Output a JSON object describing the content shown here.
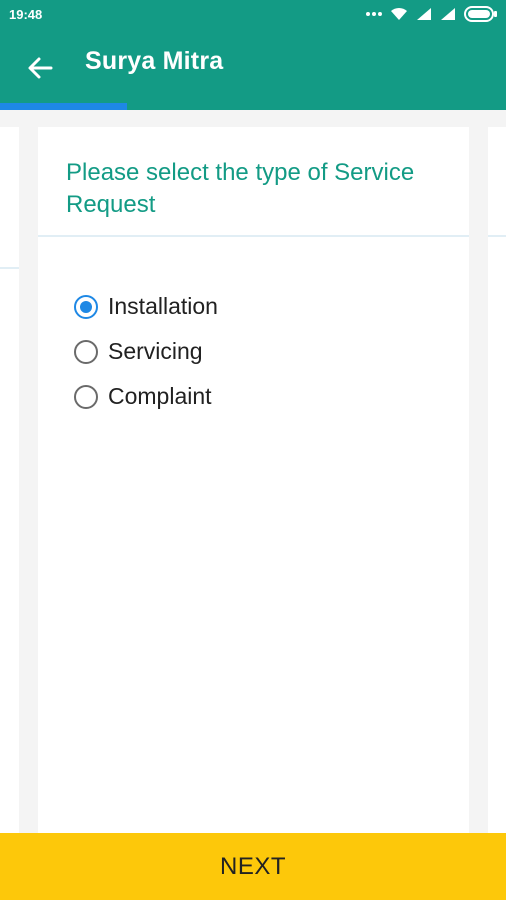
{
  "status_bar": {
    "time": "19:48",
    "icons": [
      "more-dots-icon",
      "wifi-icon",
      "signal-icon",
      "signal-icon",
      "battery-icon"
    ]
  },
  "app_bar": {
    "title": "Surya Mitra",
    "back_icon": "arrow-left-icon"
  },
  "progress": {
    "fraction": 0.25,
    "color": "#1e88e5"
  },
  "colors": {
    "primary": "#139b85",
    "accent": "#1e88e5",
    "button": "#fdc80a"
  },
  "form": {
    "question": "Please select the type of Service Request",
    "options": [
      {
        "label": "Installation",
        "selected": true
      },
      {
        "label": "Servicing",
        "selected": false
      },
      {
        "label": "Complaint",
        "selected": false
      }
    ]
  },
  "footer": {
    "next_label": "NEXT"
  }
}
